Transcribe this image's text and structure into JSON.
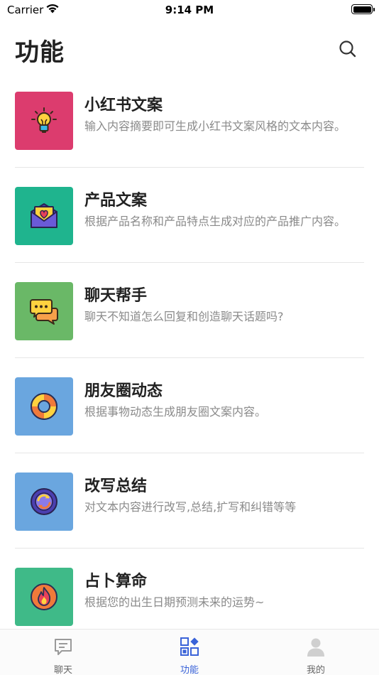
{
  "status_bar": {
    "carrier": "Carrier",
    "time": "9:14 PM"
  },
  "header": {
    "title": "功能",
    "search_icon": "search-icon"
  },
  "features": [
    {
      "title": "小红书文案",
      "desc": "输入内容摘要即可生成小红书文案风格的文本内容。",
      "icon": "lightbulb-icon",
      "color": "#dc3c6e"
    },
    {
      "title": "产品文案",
      "desc": "根据产品名称和产品特点生成对应的产品推广内容。",
      "icon": "heart-envelope-icon",
      "color": "#1fb48e"
    },
    {
      "title": "聊天帮手",
      "desc": "聊天不知道怎么回复和创造聊天话题吗?",
      "icon": "chat-bubbles-icon",
      "color": "#6ab867"
    },
    {
      "title": "朋友圈动态",
      "desc": "根据事物动态生成朋友圈文案内容。",
      "icon": "lifebuoy-icon",
      "color": "#6aa6df"
    },
    {
      "title": "改写总结",
      "desc": "对文本内容进行改写,总结,扩写和纠错等等",
      "icon": "refresh-circle-icon",
      "color": "#6aa6df"
    },
    {
      "title": "占卜算命",
      "desc": "根据您的出生日期预测未来的运势~",
      "icon": "flame-icon",
      "color": "#3fba88"
    }
  ],
  "tabs": [
    {
      "label": "聊天",
      "icon": "chat-tab-icon"
    },
    {
      "label": "功能",
      "icon": "grid-tab-icon",
      "active": true
    },
    {
      "label": "我的",
      "icon": "user-tab-icon"
    }
  ],
  "colors": {
    "accent": "#3a63d8",
    "divider": "#e6e6e6",
    "desc_text": "#8a8a8a"
  }
}
